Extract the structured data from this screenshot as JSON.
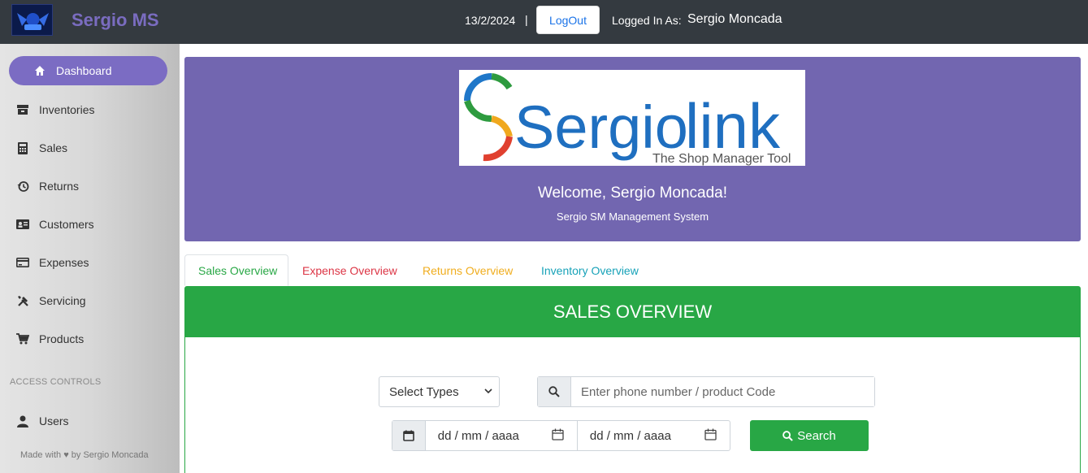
{
  "header": {
    "app_name": "Sergio MS",
    "date": "13/2/2024",
    "separator": "|",
    "logout_label": "LogOut",
    "logged_in_label": "Logged In As:",
    "user_name": "Sergio Moncada"
  },
  "sidebar": {
    "items": [
      {
        "label": "Dashboard",
        "icon": "home-icon"
      },
      {
        "label": "Inventories",
        "icon": "archive-icon"
      },
      {
        "label": "Sales",
        "icon": "calculator-icon"
      },
      {
        "label": "Returns",
        "icon": "history-icon"
      },
      {
        "label": "Customers",
        "icon": "id-card-icon"
      },
      {
        "label": "Expenses",
        "icon": "credit-card-icon"
      },
      {
        "label": "Servicing",
        "icon": "tools-icon"
      },
      {
        "label": "Products",
        "icon": "cart-icon"
      }
    ],
    "section_label": "ACCESS CONTROLS",
    "access_items": [
      {
        "label": "Users",
        "icon": "user-icon"
      }
    ],
    "footer": "Made with ♥ by Sergio Moncada"
  },
  "hero": {
    "brand_text_1": "Sergio",
    "brand_text_2": "link",
    "brand_tagline": "The Shop Manager Tool",
    "welcome": "Welcome, Sergio Moncada!",
    "subtitle": "Sergio SM Management System"
  },
  "tabs": [
    {
      "label": "Sales Overview",
      "color": "#28a745"
    },
    {
      "label": "Expense Overview",
      "color": "#dc3545"
    },
    {
      "label": "Returns Overview",
      "color": "#f0ad1e"
    },
    {
      "label": "Inventory Overview",
      "color": "#17a2b8"
    }
  ],
  "panel": {
    "title": "SALES OVERVIEW",
    "select_value": "Select Types",
    "search_placeholder": "Enter phone number / product Code",
    "date_from": "dd / mm / aaaa",
    "date_to": "dd / mm / aaaa",
    "search_button": "Search"
  },
  "colors": {
    "topbar": "#343a40",
    "accent": "#7266b0",
    "success": "#28a745"
  }
}
